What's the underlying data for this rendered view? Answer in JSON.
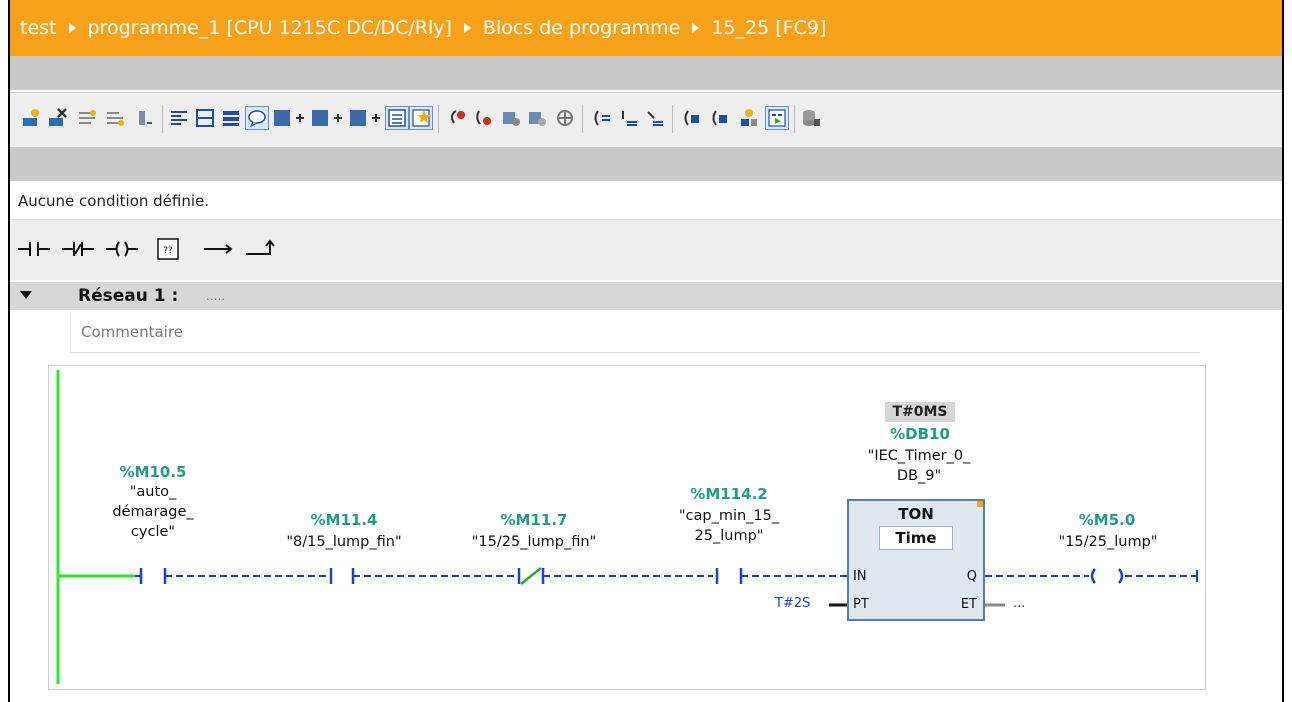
{
  "breadcrumb": {
    "items": [
      "test",
      "programme_1 [CPU 1215C DC/DC/Rly]",
      "Blocs de programme",
      "15_25 [FC9]"
    ]
  },
  "colors": {
    "title_bar": "#f7a21a",
    "address_text": "#1f9d8a",
    "power_rail": "#2ee62e",
    "wire": "#1a3fd6"
  },
  "toolbar": {
    "icons": [
      "insert-network-icon",
      "delete-network-icon",
      "insert-row-icon",
      "append-row-icon",
      "clear-icon",
      "toggle-absolute-icon",
      "collapse-all-icon",
      "expand-all-icon",
      "comment-icon",
      "network-zoom-in-icon",
      "network-zoom-out-icon",
      "address-display-icon",
      "block-interface-icon",
      "favorites-icon",
      "go-to-previous-error-icon",
      "go-to-next-error-icon",
      "update-call-icon",
      "compare-icon",
      "monitor-icon",
      "jump-icon",
      "indent-icon",
      "outdent-icon",
      "call-back-icon",
      "call-forward-icon",
      "module-info-icon",
      "monitoring-on-off-icon",
      "database-icon"
    ]
  },
  "condition_text": "Aucune condition définie.",
  "instructions": [
    "normally-open-contact-icon",
    "normally-closed-contact-icon",
    "coil-icon",
    "empty-box-icon",
    "open-branch-icon",
    "close-branch-icon"
  ],
  "network": {
    "title": "Réseau 1 :",
    "title_extra": ".....",
    "comment_placeholder": "Commentaire"
  },
  "ladder": {
    "contacts": [
      {
        "address": "%M10.5",
        "name": "\"auto_\ndémarage_\ncycle\"",
        "type": "NO"
      },
      {
        "address": "%M11.4",
        "name": "\"8/15_lump_fin\"",
        "type": "NO"
      },
      {
        "address": "%M11.7",
        "name": "\"15/25_lump_fin\"",
        "type": "NC"
      },
      {
        "address": "%M114.2",
        "name": "\"cap_min_15_\n25_lump\"",
        "type": "NO"
      }
    ],
    "timer": {
      "current_value": "T#0MS",
      "db_address": "%DB10",
      "db_name": "\"IEC_Timer_0_\nDB_9\"",
      "type": "TON",
      "data_type": "Time",
      "pin_in": "IN",
      "pin_pt": "PT",
      "pin_q": "Q",
      "pin_et": "ET",
      "pt_value": "T#2S",
      "et_value": "..."
    },
    "coil": {
      "address": "%M5.0",
      "name": "\"15/25_lump\""
    }
  }
}
